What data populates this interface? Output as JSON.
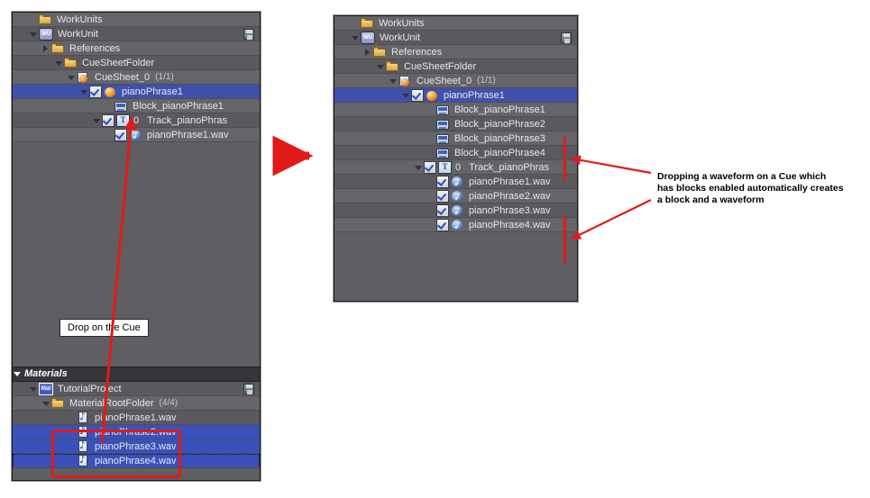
{
  "left_panel": {
    "work_units_tree": [
      {
        "indent": 1,
        "tri": "",
        "check": false,
        "icon": "folder-icon",
        "label": "WorkUnits",
        "count": "",
        "state": "alt",
        "save": false
      },
      {
        "indent": 1,
        "tri": "down",
        "check": false,
        "icon": "workunit-badge-icon",
        "label": "WorkUnit",
        "count": "",
        "state": "dark",
        "save": true
      },
      {
        "indent": 2,
        "tri": "right",
        "check": false,
        "icon": "folder-icon",
        "label": "References",
        "count": "",
        "state": "alt",
        "save": false
      },
      {
        "indent": 3,
        "tri": "down",
        "check": false,
        "icon": "folder-icon",
        "label": "CueSheetFolder",
        "count": "",
        "state": "dark",
        "save": false
      },
      {
        "indent": 4,
        "tri": "down",
        "check": false,
        "icon": "cuesheet-icon",
        "label": "CueSheet_0",
        "count": "(1/1)",
        "state": "alt",
        "save": false
      },
      {
        "indent": 5,
        "tri": "down",
        "check": true,
        "icon": "cue-sphere-icon",
        "label": "pianoPhrase1",
        "count": "",
        "state": "selected",
        "save": false
      },
      {
        "indent": 7,
        "tri": "",
        "check": false,
        "icon": "block-icon",
        "label": "Block_pianoPhrase1",
        "count": "",
        "state": "alt",
        "save": false
      },
      {
        "indent": 6,
        "tri": "down",
        "check": true,
        "icon": "track-icon",
        "label": "Track_pianoPhras",
        "count": "",
        "tracknum": "0",
        "state": "dark",
        "save": false
      },
      {
        "indent": 7,
        "tri": "",
        "check": true,
        "icon": "waveform-icon",
        "label": "pianoPhrase1.wav",
        "count": "",
        "state": "alt",
        "save": false
      }
    ],
    "materials_section": {
      "header_label": "Materials",
      "tree": [
        {
          "indent": 1,
          "tri": "down",
          "check": false,
          "icon": "material-badge-icon",
          "label": "TutorialProject",
          "count": "",
          "state": "dark",
          "save": true
        },
        {
          "indent": 2,
          "tri": "down",
          "check": false,
          "icon": "folder-icon",
          "label": "MaterialRootFolder",
          "count": "(4/4)",
          "state": "alt",
          "save": false
        },
        {
          "indent": 4,
          "tri": "",
          "check": false,
          "icon": "wavfile-icon",
          "label": "pianoPhrase1.wav",
          "count": "",
          "state": "dark",
          "save": false
        },
        {
          "indent": 4,
          "tri": "",
          "check": false,
          "icon": "wavfile-icon",
          "label": "pianoPhrase2.wav",
          "count": "",
          "state": "selected-mat",
          "save": false
        },
        {
          "indent": 4,
          "tri": "",
          "check": false,
          "icon": "wavfile-icon",
          "label": "pianoPhrase3.wav",
          "count": "",
          "state": "selected-mat",
          "save": false
        },
        {
          "indent": 4,
          "tri": "",
          "check": false,
          "icon": "wavfile-icon",
          "label": "pianoPhrase4.wav",
          "count": "",
          "state": "selected-mat",
          "focus": true,
          "save": false
        }
      ]
    },
    "drop_callout": "Drop on the Cue"
  },
  "right_panel": {
    "tree": [
      {
        "indent": 1,
        "tri": "",
        "check": false,
        "icon": "folder-icon",
        "label": "WorkUnits",
        "count": "",
        "state": "alt",
        "save": false
      },
      {
        "indent": 1,
        "tri": "down",
        "check": false,
        "icon": "workunit-badge-icon",
        "label": "WorkUnit",
        "count": "",
        "state": "dark",
        "save": true
      },
      {
        "indent": 2,
        "tri": "right",
        "check": false,
        "icon": "folder-icon",
        "label": "References",
        "count": "",
        "state": "alt",
        "save": false
      },
      {
        "indent": 3,
        "tri": "down",
        "check": false,
        "icon": "folder-icon",
        "label": "CueSheetFolder",
        "count": "",
        "state": "dark",
        "save": false
      },
      {
        "indent": 4,
        "tri": "down",
        "check": false,
        "icon": "cuesheet-icon",
        "label": "CueSheet_0",
        "count": "(1/1)",
        "state": "alt",
        "save": false
      },
      {
        "indent": 5,
        "tri": "down",
        "check": true,
        "icon": "cue-sphere-icon",
        "label": "pianoPhrase1",
        "count": "",
        "state": "selected",
        "save": false
      },
      {
        "indent": 7,
        "tri": "",
        "check": false,
        "icon": "block-icon",
        "label": "Block_pianoPhrase1",
        "count": "",
        "state": "alt",
        "save": false
      },
      {
        "indent": 7,
        "tri": "",
        "check": false,
        "icon": "block-icon",
        "label": "Block_pianoPhrase2",
        "count": "",
        "state": "dark",
        "save": false
      },
      {
        "indent": 7,
        "tri": "",
        "check": false,
        "icon": "block-icon",
        "label": "Block_pianoPhrase3",
        "count": "",
        "state": "alt",
        "save": false
      },
      {
        "indent": 7,
        "tri": "",
        "check": false,
        "icon": "block-icon",
        "label": "Block_pianoPhrase4",
        "count": "",
        "state": "dark",
        "save": false
      },
      {
        "indent": 6,
        "tri": "down",
        "check": true,
        "icon": "track-icon",
        "label": "Track_pianoPhras",
        "count": "",
        "tracknum": "0",
        "state": "alt",
        "save": false
      },
      {
        "indent": 7,
        "tri": "",
        "check": true,
        "icon": "waveform-icon",
        "label": "pianoPhrase1.wav",
        "count": "",
        "state": "dark",
        "save": false
      },
      {
        "indent": 7,
        "tri": "",
        "check": true,
        "icon": "waveform-icon",
        "label": "pianoPhrase2.wav",
        "count": "",
        "state": "alt",
        "save": false
      },
      {
        "indent": 7,
        "tri": "",
        "check": true,
        "icon": "waveform-icon",
        "label": "pianoPhrase3.wav",
        "count": "",
        "state": "dark",
        "save": false
      },
      {
        "indent": 7,
        "tri": "",
        "check": true,
        "icon": "waveform-icon",
        "label": "pianoPhrase4.wav",
        "count": "",
        "state": "alt",
        "save": false
      }
    ]
  },
  "annotation": {
    "line1": "Dropping a waveform on a Cue which",
    "line2": "has blocks enabled automatically creates",
    "line3": "a block and a waveform",
    "accent_color": "#e01b18"
  }
}
